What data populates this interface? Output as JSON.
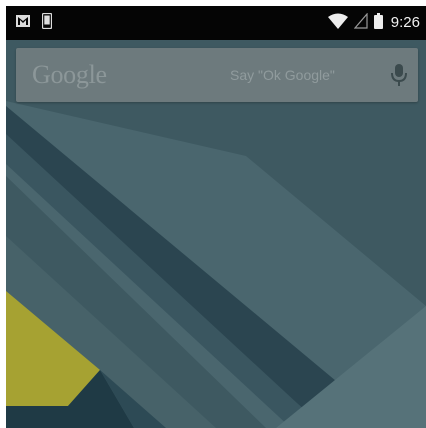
{
  "status_bar": {
    "time": "9:26",
    "icons": [
      "gmail-notification-icon",
      "phone-notification-icon",
      "wifi-icon",
      "cell-signal-icon",
      "battery-icon"
    ]
  },
  "search_widget": {
    "logo": "Google",
    "hint": "Say \"Ok Google\"",
    "icon": "microphone-icon"
  },
  "wallpaper": {
    "colors": {
      "base": "#3e5961",
      "dark_stripe": "#2b4550",
      "light_band": "#4d6a72",
      "lower_panel": "#476269",
      "accent_yellow": "#a6a232",
      "deep_corner": "#1f3a45",
      "right_panel": "#567279"
    }
  }
}
